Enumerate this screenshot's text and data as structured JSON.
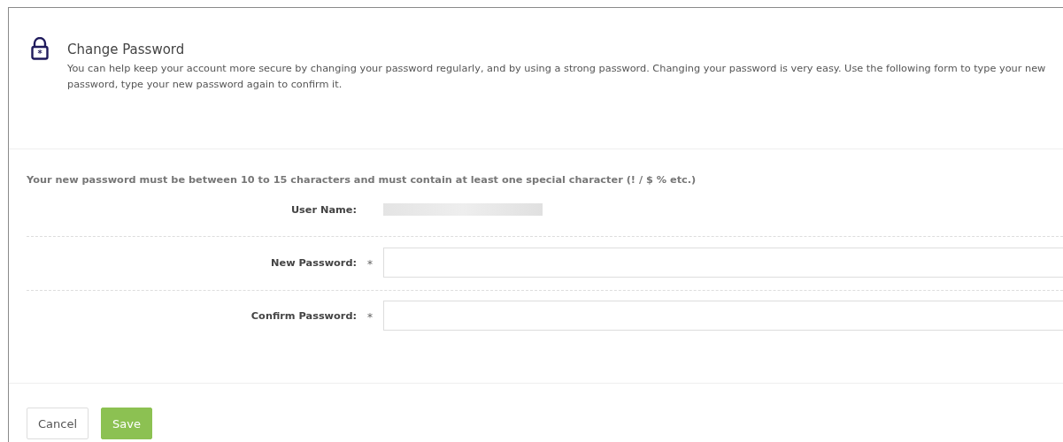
{
  "header": {
    "title": "Change Password",
    "description": "You can help keep your account more secure by changing your password regularly, and by using a strong password. Changing your password is very easy. Use the following form to type your new password, type your new password again to confirm it."
  },
  "requirement": "Your new password must be between 10 to 15 characters and must contain at least one special character (! / $ % etc.)",
  "fields": [
    {
      "label": "User Name:",
      "kind": "redacted",
      "required": false
    },
    {
      "label": "New Password:",
      "kind": "input",
      "required": true
    },
    {
      "label": "Confirm Password:",
      "kind": "input",
      "required": true
    }
  ],
  "required_mark": "*",
  "buttons": [
    {
      "label": "Cancel",
      "kind": "default"
    },
    {
      "label": "Save",
      "kind": "primary"
    }
  ]
}
